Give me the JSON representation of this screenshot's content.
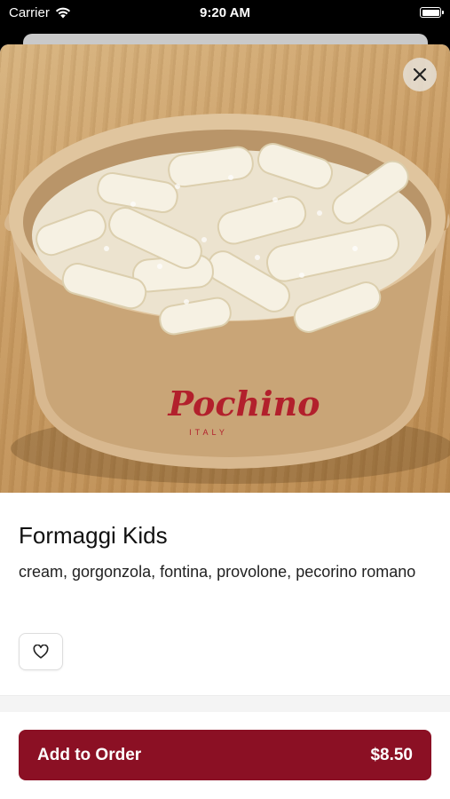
{
  "status_bar": {
    "carrier": "Carrier",
    "time": "9:20 AM"
  },
  "product": {
    "title": "Formaggi Kids",
    "description": "cream, gorgonzola, fontina, provolone, pecorino romano",
    "image_alt": "Bowl of macaroni with cheese",
    "brand_logo": "Pochino",
    "brand_subtitle": "ITALY"
  },
  "actions": {
    "add_to_order_label": "Add to Order",
    "price": "$8.50"
  },
  "colors": {
    "accent": "#8b1024"
  },
  "icons": [
    "wifi-icon",
    "battery-icon",
    "close-icon",
    "heart-icon"
  ]
}
